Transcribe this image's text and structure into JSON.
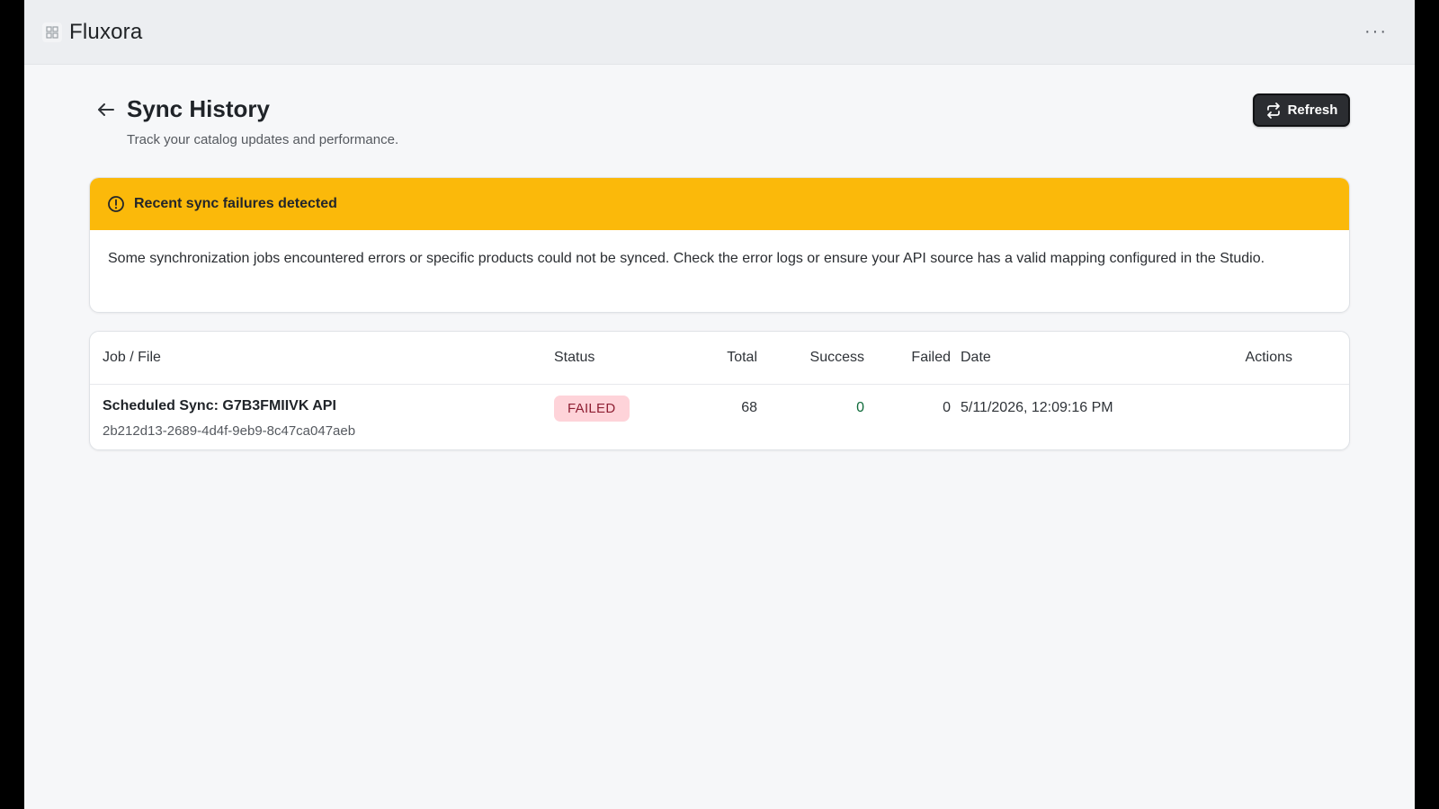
{
  "app": {
    "title": "Fluxora",
    "icon": "app-logo-icon",
    "more_label": "···"
  },
  "header": {
    "title": "Sync History",
    "subtitle": "Track your catalog updates and performance.",
    "refresh_label": "Refresh"
  },
  "alert": {
    "title": "Recent sync failures detected",
    "message": "Some synchronization jobs encountered errors or specific products could not be synced. Check the error logs or ensure your API source has a valid mapping configured in the Studio.",
    "color": "#fbb90a"
  },
  "table": {
    "columns": {
      "job": "Job / File",
      "status": "Status",
      "total": "Total",
      "success": "Success",
      "failed": "Failed",
      "date": "Date",
      "actions": "Actions"
    },
    "rows": [
      {
        "name": "Scheduled Sync: G7B3FMIIVK API",
        "id": "2b212d13-2689-4d4f-9eb9-8c47ca047aeb",
        "status": "FAILED",
        "total": "68",
        "success": "0",
        "failed": "0",
        "date": "5/11/2026, 12:09:16 PM"
      }
    ]
  },
  "colors": {
    "status_failed_bg": "#fed3d9",
    "status_failed_text": "#8e1f33",
    "success_text": "#0f6b3a",
    "button_dark": "#2b2d31"
  }
}
